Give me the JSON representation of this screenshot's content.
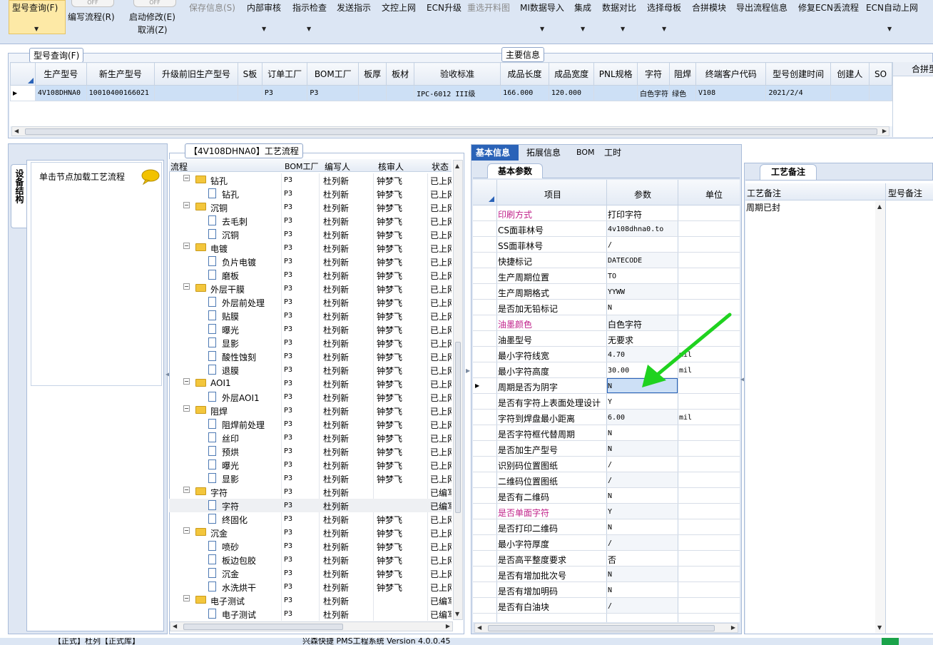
{
  "toolbar": {
    "query": "型号查询(F)",
    "write_flow": "编写流程(R)",
    "start_modify": "启动修改(E)",
    "cancel": "取消(Z)",
    "save_info": "保存信息(S)",
    "internal_review": "内部审核",
    "instruction_check": "指示检查",
    "send_instruction": "发送指示",
    "doc_online": "文控上网",
    "ecn_upgrade": "ECN升级",
    "reselect_layout": "重选开料图",
    "mi_import": "MI数据导入",
    "integrate": "集成",
    "data_compare": "数据对比",
    "select_mother": "选择母板",
    "merge_module": "合拼模块",
    "export_flow": "导出流程信息",
    "repair_ecn": "修复ECN丢流程",
    "ecn_auto": "ECN自动上网",
    "toggle_off": "OFF"
  },
  "query_panel": {
    "legend": "型号查询(F)",
    "main_info_tab": "主要信息",
    "merge_tab": "合拼型",
    "columns": [
      "生产型号",
      "新生产型号",
      "升级前旧生产型号",
      "S板",
      "订单工厂",
      "BOM工厂",
      "板厚",
      "板材",
      "验收标准",
      "成品长度",
      "成品宽度",
      "PNL规格",
      "字符",
      "阻焊",
      "终端客户代码",
      "型号创建时间",
      "创建人",
      "SO"
    ],
    "row": [
      "4V108DHNA0",
      "10010400166021",
      "",
      "",
      "P3",
      "P3",
      "",
      "",
      "IPC-6012 III级",
      "166.000",
      "120.000",
      "",
      "白色字符",
      "绿色",
      "V108",
      "2021/2/4",
      "",
      ""
    ]
  },
  "left_panel": {
    "side_tab": "设备结构",
    "hint": "单击节点加载工艺流程"
  },
  "flow_panel": {
    "legend": "【4V108DHNA0】工艺流程",
    "columns": [
      "流程",
      "BOM工厂",
      "编写人",
      "核审人",
      "状态"
    ],
    "rows": [
      {
        "name": "钻孔",
        "lvl": 0,
        "bom": "P3",
        "writer": "杜列新",
        "reviewer": "钟梦飞",
        "status": "已上网"
      },
      {
        "name": "钻孔",
        "lvl": 1,
        "bom": "P3",
        "writer": "杜列新",
        "reviewer": "钟梦飞",
        "status": "已上网"
      },
      {
        "name": "沉铜",
        "lvl": 0,
        "bom": "P3",
        "writer": "杜列新",
        "reviewer": "钟梦飞",
        "status": "已上网"
      },
      {
        "name": "去毛刺",
        "lvl": 1,
        "bom": "P3",
        "writer": "杜列新",
        "reviewer": "钟梦飞",
        "status": "已上网"
      },
      {
        "name": "沉铜",
        "lvl": 1,
        "bom": "P3",
        "writer": "杜列新",
        "reviewer": "钟梦飞",
        "status": "已上网"
      },
      {
        "name": "电镀",
        "lvl": 0,
        "bom": "P3",
        "writer": "杜列新",
        "reviewer": "钟梦飞",
        "status": "已上网"
      },
      {
        "name": "负片电镀",
        "lvl": 1,
        "bom": "P3",
        "writer": "杜列新",
        "reviewer": "钟梦飞",
        "status": "已上网"
      },
      {
        "name": "磨板",
        "lvl": 1,
        "bom": "P3",
        "writer": "杜列新",
        "reviewer": "钟梦飞",
        "status": "已上网"
      },
      {
        "name": "外层干膜",
        "lvl": 0,
        "bom": "P3",
        "writer": "杜列新",
        "reviewer": "钟梦飞",
        "status": "已上网"
      },
      {
        "name": "外层前处理",
        "lvl": 1,
        "bom": "P3",
        "writer": "杜列新",
        "reviewer": "钟梦飞",
        "status": "已上网"
      },
      {
        "name": "贴膜",
        "lvl": 1,
        "bom": "P3",
        "writer": "杜列新",
        "reviewer": "钟梦飞",
        "status": "已上网"
      },
      {
        "name": "曝光",
        "lvl": 1,
        "bom": "P3",
        "writer": "杜列新",
        "reviewer": "钟梦飞",
        "status": "已上网"
      },
      {
        "name": "显影",
        "lvl": 1,
        "bom": "P3",
        "writer": "杜列新",
        "reviewer": "钟梦飞",
        "status": "已上网"
      },
      {
        "name": "酸性蚀刻",
        "lvl": 1,
        "bom": "P3",
        "writer": "杜列新",
        "reviewer": "钟梦飞",
        "status": "已上网"
      },
      {
        "name": "退膜",
        "lvl": 1,
        "bom": "P3",
        "writer": "杜列新",
        "reviewer": "钟梦飞",
        "status": "已上网"
      },
      {
        "name": "AOI1",
        "lvl": 0,
        "bom": "P3",
        "writer": "杜列新",
        "reviewer": "钟梦飞",
        "status": "已上网"
      },
      {
        "name": "外层AOI1",
        "lvl": 1,
        "bom": "P3",
        "writer": "杜列新",
        "reviewer": "钟梦飞",
        "status": "已上网"
      },
      {
        "name": "阻焊",
        "lvl": 0,
        "bom": "P3",
        "writer": "杜列新",
        "reviewer": "钟梦飞",
        "status": "已上网"
      },
      {
        "name": "阻焊前处理",
        "lvl": 1,
        "bom": "P3",
        "writer": "杜列新",
        "reviewer": "钟梦飞",
        "status": "已上网"
      },
      {
        "name": "丝印",
        "lvl": 1,
        "bom": "P3",
        "writer": "杜列新",
        "reviewer": "钟梦飞",
        "status": "已上网"
      },
      {
        "name": "预烘",
        "lvl": 1,
        "bom": "P3",
        "writer": "杜列新",
        "reviewer": "钟梦飞",
        "status": "已上网"
      },
      {
        "name": "曝光",
        "lvl": 1,
        "bom": "P3",
        "writer": "杜列新",
        "reviewer": "钟梦飞",
        "status": "已上网"
      },
      {
        "name": "显影",
        "lvl": 1,
        "bom": "P3",
        "writer": "杜列新",
        "reviewer": "钟梦飞",
        "status": "已上网"
      },
      {
        "name": "字符",
        "lvl": 0,
        "bom": "P3",
        "writer": "杜列新",
        "reviewer": "",
        "status": "已编写"
      },
      {
        "name": "字符",
        "lvl": 1,
        "bom": "P3",
        "writer": "杜列新",
        "reviewer": "",
        "status": "已编写"
      },
      {
        "name": "终固化",
        "lvl": 1,
        "bom": "P3",
        "writer": "杜列新",
        "reviewer": "钟梦飞",
        "status": "已上网"
      },
      {
        "name": "沉金",
        "lvl": 0,
        "bom": "P3",
        "writer": "杜列新",
        "reviewer": "钟梦飞",
        "status": "已上网"
      },
      {
        "name": "喷砂",
        "lvl": 1,
        "bom": "P3",
        "writer": "杜列新",
        "reviewer": "钟梦飞",
        "status": "已上网"
      },
      {
        "name": "板边包胶",
        "lvl": 1,
        "bom": "P3",
        "writer": "杜列新",
        "reviewer": "钟梦飞",
        "status": "已上网"
      },
      {
        "name": "沉金",
        "lvl": 1,
        "bom": "P3",
        "writer": "杜列新",
        "reviewer": "钟梦飞",
        "status": "已上网"
      },
      {
        "name": "水洗烘干",
        "lvl": 1,
        "bom": "P3",
        "writer": "杜列新",
        "reviewer": "钟梦飞",
        "status": "已上网"
      },
      {
        "name": "电子测试",
        "lvl": 0,
        "bom": "P3",
        "writer": "杜列新",
        "reviewer": "",
        "status": "已编写"
      },
      {
        "name": "电子测试",
        "lvl": 1,
        "bom": "P3",
        "writer": "杜列新",
        "reviewer": "",
        "status": "已编写"
      }
    ]
  },
  "detail_panel": {
    "tabs": [
      "基本信息",
      "拓展信息",
      "BOM",
      "工时"
    ],
    "subtab": "基本参数",
    "columns": [
      "项目",
      "参数",
      "单位"
    ],
    "rows": [
      {
        "item": "印刷方式",
        "value": "打印字符",
        "unit": "",
        "pink": true
      },
      {
        "item": "CS面菲林号",
        "value": "4v108dhna0.to",
        "unit": "",
        "pink": false
      },
      {
        "item": "SS面菲林号",
        "value": "/",
        "unit": "",
        "pink": false
      },
      {
        "item": "快捷标记",
        "value": "DATECODE",
        "unit": "",
        "pink": false
      },
      {
        "item": "生产周期位置",
        "value": "TO",
        "unit": "",
        "pink": false
      },
      {
        "item": "生产周期格式",
        "value": "YYWW",
        "unit": "",
        "pink": false
      },
      {
        "item": "是否加无铅标记",
        "value": "N",
        "unit": "",
        "pink": false
      },
      {
        "item": "油墨颜色",
        "value": "白色字符",
        "unit": "",
        "pink": true
      },
      {
        "item": "油墨型号",
        "value": "无要求",
        "unit": "",
        "pink": false
      },
      {
        "item": "最小字符线宽",
        "value": "4.70",
        "unit": "mil",
        "pink": false
      },
      {
        "item": "最小字符高度",
        "value": "30.00",
        "unit": "mil",
        "pink": false
      },
      {
        "item": "周期是否为阴字",
        "value": "N",
        "unit": "",
        "pink": false
      },
      {
        "item": "是否有字符上表面处理设计",
        "value": "Y",
        "unit": "",
        "pink": false
      },
      {
        "item": "字符到焊盘最小距离",
        "value": "6.00",
        "unit": "mil",
        "pink": false
      },
      {
        "item": "是否字符框代替周期",
        "value": "N",
        "unit": "",
        "pink": false
      },
      {
        "item": "是否加生产型号",
        "value": "N",
        "unit": "",
        "pink": false
      },
      {
        "item": "识别码位置图纸",
        "value": "/",
        "unit": "",
        "pink": false
      },
      {
        "item": "二维码位置图纸",
        "value": "/",
        "unit": "",
        "pink": false
      },
      {
        "item": "是否有二维码",
        "value": "N",
        "unit": "",
        "pink": false
      },
      {
        "item": "是否单面字符",
        "value": "Y",
        "unit": "",
        "pink": true
      },
      {
        "item": "是否打印二维码",
        "value": "N",
        "unit": "",
        "pink": false
      },
      {
        "item": "最小字符厚度",
        "value": "/",
        "unit": "",
        "pink": false
      },
      {
        "item": "是否高平整度要求",
        "value": "否",
        "unit": "",
        "pink": false
      },
      {
        "item": "是否有增加批次号",
        "value": "N",
        "unit": "",
        "pink": false
      },
      {
        "item": "是否有增加明码",
        "value": "N",
        "unit": "",
        "pink": false
      },
      {
        "item": "是否有白油块",
        "value": "/",
        "unit": "",
        "pink": false
      }
    ]
  },
  "remark_panel": {
    "tab": "工艺备注",
    "col_process": "工艺备注",
    "col_model": "型号备注",
    "text": "周期已封"
  },
  "status_bar": {
    "left": "【正式】杜列【正式库】",
    "center": "兴森快捷 PMS工程系统 Version 4.0.0.45"
  },
  "colors": {
    "accent": "#2a63b8",
    "selection": "#cde0f6",
    "arrow": "#1fd21f"
  }
}
